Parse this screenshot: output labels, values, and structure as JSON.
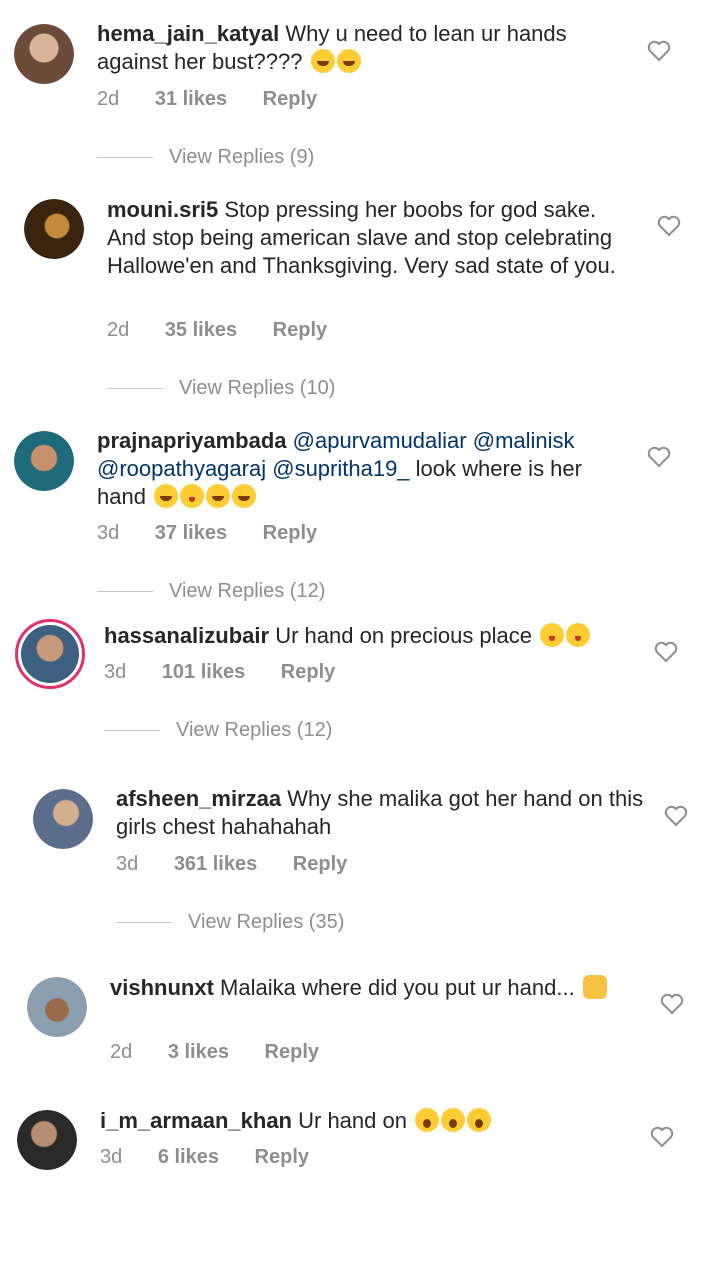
{
  "comments": [
    {
      "username": "hema_jain_katyal",
      "text": "Why u need to lean ur hands against her bust????",
      "emojis": [
        "grin",
        "grin"
      ],
      "time": "2d",
      "likes": "31 likes",
      "reply": "Reply",
      "view_replies": "View Replies (9)",
      "avatar_color": "#8c6b5a"
    },
    {
      "username": "mouni.sri5",
      "text": "Stop pressing her boobs for god sake. And stop being american slave and stop celebrating Hallowe'en and Thanksgiving. Very sad state of you.",
      "time": "2d",
      "likes": "35 likes",
      "reply": "Reply",
      "view_replies": "View Replies (10)",
      "avatar_color": "#5a3a1e"
    },
    {
      "username": "prajnapriyambada",
      "mentions": [
        "@apurvamudaliar",
        "@malinisk",
        "@roopathyagaraj",
        "@supritha19_"
      ],
      "text": "look where is her hand",
      "emojis": [
        "grin",
        "kiss",
        "grin",
        "grin"
      ],
      "time": "3d",
      "likes": "37 likes",
      "reply": "Reply",
      "view_replies": "View Replies (12)",
      "avatar_color": "#2e7d8c"
    },
    {
      "username": "hassanalizubair",
      "text": "Ur hand on precious place",
      "emojis": [
        "kiss",
        "kiss"
      ],
      "time": "3d",
      "likes": "101 likes",
      "reply": "Reply",
      "view_replies": "View Replies (12)",
      "avatar_color": "#4a6c8a"
    },
    {
      "username": "afsheen_mirzaa",
      "text": "Why she malika got her hand on this girls chest hahahahah",
      "time": "3d",
      "likes": "361 likes",
      "reply": "Reply",
      "view_replies": "View Replies (35)",
      "avatar_color": "#6d7f9a"
    },
    {
      "username": "vishnunxt",
      "text": "Malaika where did you put ur hand...",
      "emojis": [
        "hands"
      ],
      "time": "2d",
      "likes": "3 likes",
      "reply": "Reply",
      "avatar_color": "#7a8a6c"
    },
    {
      "username": "i_m_armaan_khan",
      "text": "Ur hand on",
      "emojis": [
        "wow",
        "wow",
        "wow"
      ],
      "time": "3d",
      "likes": "6 likes",
      "reply": "Reply",
      "avatar_color": "#3a3a3a"
    }
  ]
}
